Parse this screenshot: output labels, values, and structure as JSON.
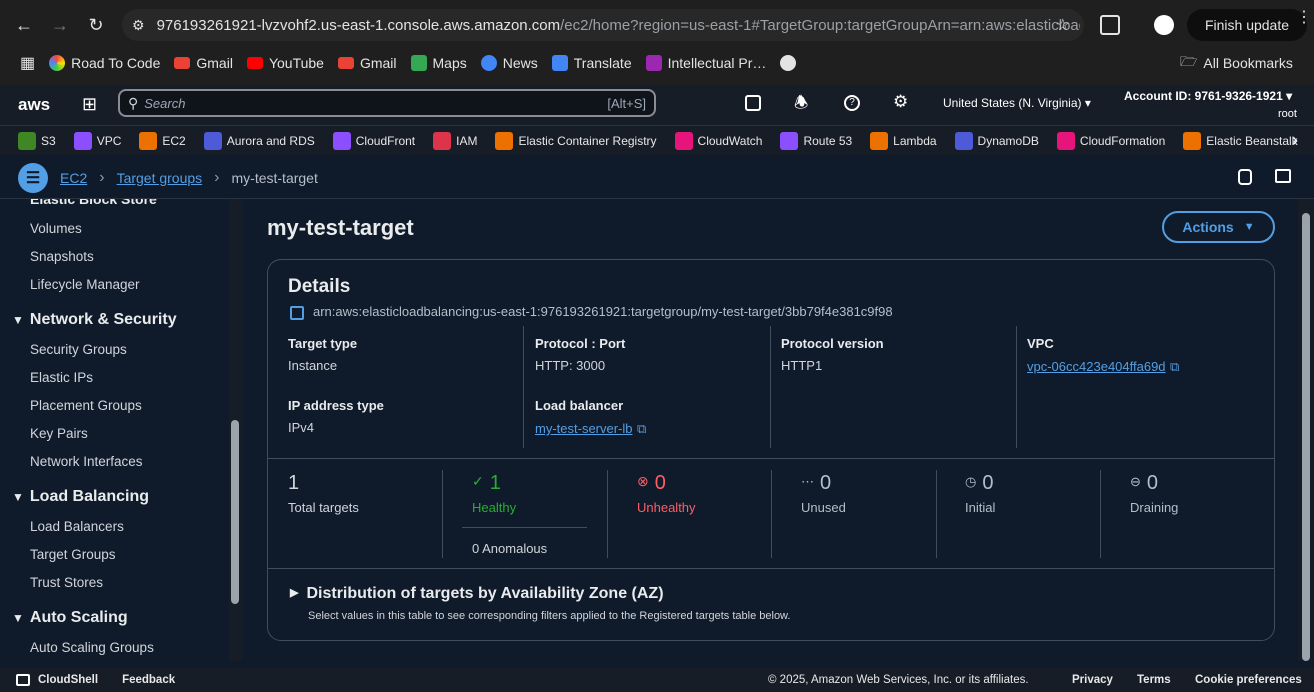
{
  "browser": {
    "url_host": "976193261921-lvzvohf2.us-east-1.console.aws.amazon.com",
    "url_path": "/ec2/home?region=us-east-1#TargetGroup:targetGroupArn=arn:aws:elasticload…",
    "finish_update": "Finish update",
    "bookmarks": [
      "Road To Code",
      "Gmail",
      "YouTube",
      "Gmail",
      "Maps",
      "News",
      "Translate",
      "Intellectual Pr…"
    ],
    "all_bookmarks": "All Bookmarks"
  },
  "aws": {
    "logo": "aws",
    "search_placeholder": "Search",
    "search_shortcut": "[Alt+S]",
    "region": "United States (N. Virginia)",
    "account": "Account ID: 9761-9326-1921",
    "user": "root",
    "services": [
      "S3",
      "VPC",
      "EC2",
      "Aurora and RDS",
      "CloudFront",
      "IAM",
      "Elastic Container Registry",
      "CloudWatch",
      "Route 53",
      "Lambda",
      "DynamoDB",
      "CloudFormation",
      "Elastic Beanstalk"
    ],
    "service_colors": [
      "#3f8624",
      "#8c4fff",
      "#ed7100",
      "#4d5bd9",
      "#8c4fff",
      "#dd344c",
      "#ed7100",
      "#e7157b",
      "#8c4fff",
      "#ed7100",
      "#4d5bd9",
      "#e7157b",
      "#ed7100"
    ]
  },
  "breadcrumb": [
    "EC2",
    "Target groups",
    "my-test-target"
  ],
  "sidebar": {
    "top_partial": "Elastic Block Store",
    "ebs_items": [
      "Volumes",
      "Snapshots",
      "Lifecycle Manager"
    ],
    "network": {
      "title": "Network & Security",
      "items": [
        "Security Groups",
        "Elastic IPs",
        "Placement Groups",
        "Key Pairs",
        "Network Interfaces"
      ]
    },
    "lb": {
      "title": "Load Balancing",
      "items": [
        "Load Balancers",
        "Target Groups",
        "Trust Stores"
      ]
    },
    "as": {
      "title": "Auto Scaling",
      "items": [
        "Auto Scaling Groups"
      ]
    }
  },
  "page": {
    "title": "my-test-target",
    "actions": "Actions",
    "details_title": "Details",
    "arn": "arn:aws:elasticloadbalancing:us-east-1:976193261921:targetgroup/my-test-target/3bb79f4e381c9f98",
    "target_type_label": "Target type",
    "target_type": "Instance",
    "protocol_label": "Protocol : Port",
    "protocol": "HTTP: 3000",
    "protocol_version_label": "Protocol version",
    "protocol_version": "HTTP1",
    "vpc_label": "VPC",
    "vpc": "vpc-06cc423e404ffa69d",
    "ip_type_label": "IP address type",
    "ip_type": "IPv4",
    "lb_label": "Load balancer",
    "lb": "my-test-server-lb",
    "stats": {
      "total": "1",
      "total_label": "Total targets",
      "healthy": "1",
      "healthy_label": "Healthy",
      "anomalous": "0 Anomalous",
      "unhealthy": "0",
      "unhealthy_label": "Unhealthy",
      "unused": "0",
      "unused_label": "Unused",
      "initial": "0",
      "initial_label": "Initial",
      "draining": "0",
      "draining_label": "Draining"
    },
    "dist_title": "Distribution of targets by Availability Zone (AZ)",
    "dist_desc": "Select values in this table to see corresponding filters applied to the Registered targets table below."
  },
  "footer": {
    "cloudshell": "CloudShell",
    "feedback": "Feedback",
    "copyright": "© 2025, Amazon Web Services, Inc. or its affiliates.",
    "privacy": "Privacy",
    "terms": "Terms",
    "cookies": "Cookie preferences"
  }
}
